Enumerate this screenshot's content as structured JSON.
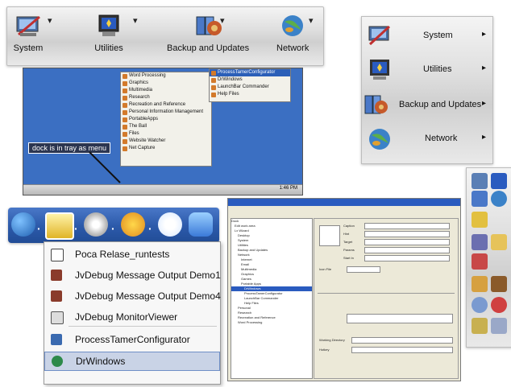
{
  "horizontal_dock": {
    "items": [
      {
        "label": "System",
        "icon": "system-icon"
      },
      {
        "label": "Utilities",
        "icon": "utilities-icon"
      },
      {
        "label": "Backup and Updates",
        "icon": "backup-icon"
      },
      {
        "label": "Network",
        "icon": "network-globe-icon"
      }
    ]
  },
  "vertical_dock": {
    "items": [
      {
        "label": "System"
      },
      {
        "label": "Utilities"
      },
      {
        "label": "Backup and Updates"
      },
      {
        "label": "Network"
      }
    ],
    "arrow": "▸"
  },
  "xp_screenshot": {
    "tooltip": "dock is in tray as menu",
    "start_menu": [
      "Word Processing",
      "Graphics",
      "Multimedia",
      "Research",
      "Recreation and Reference",
      "Personal Information Management",
      "PortableApps",
      "The Ball",
      "Files",
      "Website Watcher",
      "Net Capture"
    ],
    "submenu": [
      "ProcessTamerConfigurator",
      "DrWindows",
      "LaunchBar Commander",
      "Help Files"
    ],
    "clock": "1:46 PM"
  },
  "bottom_dock": {
    "menu_items": [
      {
        "label": "Poca Relase_runtests",
        "icon": "app-window-icon"
      },
      {
        "label": "JvDebug Message Output Demo1",
        "icon": "debug-icon"
      },
      {
        "label": "JvDebug Message Output Demo4",
        "icon": "debug-icon"
      },
      {
        "label": "JvDebug MonitorViewer",
        "icon": "monitor-icon"
      },
      {
        "label": "ProcessTamerConfigurator",
        "icon": "process-tamer-icon"
      },
      {
        "label": "DrWindows",
        "icon": "drwindows-icon"
      }
    ],
    "selected": "DrWindows"
  },
  "config_screenshot": {
    "tree_items": [
      "Dock",
      "Edit work area",
      "Lx Wizard",
      "Desktop",
      "System",
      "Utilities",
      "Backup and Updates",
      "Network",
      "Internet",
      "Email",
      "Multimedia",
      "Graphics",
      "Games",
      "Portable Apps",
      "DrWindows",
      "ProcessTamerConfigurator",
      "LaunchBar Commander",
      "Help Files",
      "Personal",
      "Research",
      "Recreation and Reference",
      "Word Processing"
    ],
    "fields": [
      "Caption",
      "Hint",
      "Target",
      "Params",
      "Start In",
      "Icon File",
      "Working Directory",
      "Hotkey"
    ]
  }
}
